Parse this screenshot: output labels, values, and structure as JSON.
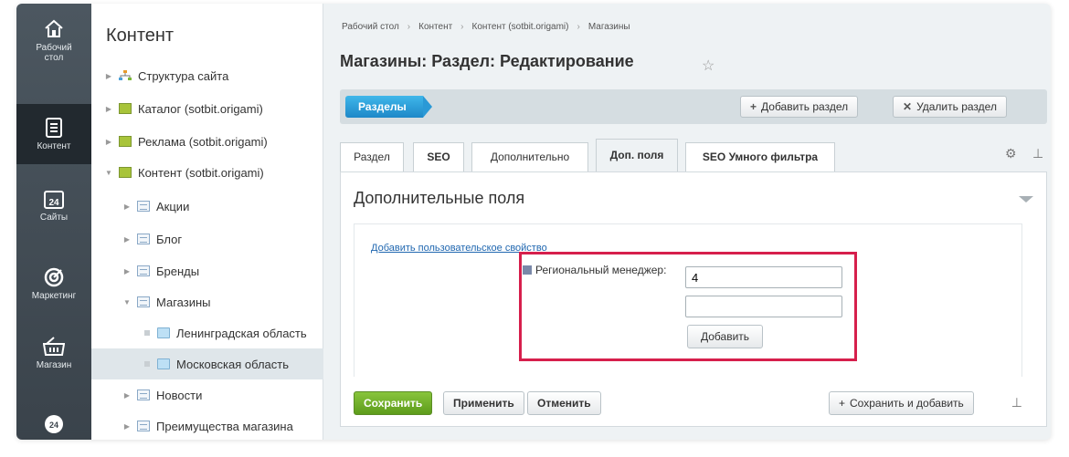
{
  "rail": [
    {
      "label": "Рабочий\nстол",
      "icon": "home-icon",
      "active": false
    },
    {
      "label": "Контент",
      "icon": "document-icon",
      "active": true
    },
    {
      "label": "Сайты",
      "icon": "calendar-icon",
      "active": false
    },
    {
      "label": "Маркетинг",
      "icon": "target-icon",
      "active": false
    },
    {
      "label": "Магазин",
      "icon": "cart-icon",
      "active": false
    },
    {
      "label": "",
      "icon": "bitrix24-icon",
      "active": false
    }
  ],
  "tree": {
    "title": "Контент",
    "items": [
      {
        "label": "Структура сайта",
        "level": 0,
        "icon": "sitemap-icon",
        "expanded": false
      },
      {
        "label": "Каталог (sotbit.origami)",
        "level": 0,
        "icon": "catalog-icon",
        "expanded": false
      },
      {
        "label": "Реклама (sotbit.origami)",
        "level": 0,
        "icon": "catalog-icon",
        "expanded": false
      },
      {
        "label": "Контент (sotbit.origami)",
        "level": 0,
        "icon": "catalog-icon",
        "expanded": true
      },
      {
        "label": "Акции",
        "level": 1,
        "icon": "list-icon",
        "expanded": false
      },
      {
        "label": "Блог",
        "level": 1,
        "icon": "list-icon",
        "expanded": false
      },
      {
        "label": "Бренды",
        "level": 1,
        "icon": "list-icon",
        "expanded": false
      },
      {
        "label": "Магазины",
        "level": 1,
        "icon": "list-icon",
        "expanded": true
      },
      {
        "label": "Ленинградская область",
        "level": 2,
        "icon": "folder-icon",
        "expanded": false
      },
      {
        "label": "Московская область",
        "level": 2,
        "icon": "folder-icon",
        "expanded": false,
        "selected": true
      },
      {
        "label": "Новости",
        "level": 1,
        "icon": "list-icon",
        "expanded": false
      },
      {
        "label": "Преимущества магазина",
        "level": 1,
        "icon": "list-icon",
        "expanded": false
      }
    ]
  },
  "breadcrumbs": [
    "Рабочий стол",
    "Контент",
    "Контент (sotbit.origami)",
    "Магазины"
  ],
  "page_title": "Магазины: Раздел: Редактирование",
  "toolbar": {
    "sections_label": "Разделы",
    "add_section": "Добавить раздел",
    "delete_section": "Удалить раздел"
  },
  "tabs": [
    "Раздел",
    "SEO",
    "Дополнительно",
    "Доп. поля",
    "SEO Умного фильтра"
  ],
  "active_tab": 3,
  "section": {
    "title": "Дополнительные поля",
    "add_property_link": "Добавить пользовательское свойство",
    "field_label": "Региональный менеджер:",
    "field_values": [
      "4",
      ""
    ],
    "add_button": "Добавить"
  },
  "footer": {
    "save": "Сохранить",
    "apply": "Применить",
    "cancel": "Отменить",
    "save_and_add": "Сохранить и добавить"
  },
  "colors": {
    "accent_blue": "#2a99d6",
    "save_green": "#6aa827",
    "highlight_red": "#d61f4c"
  }
}
